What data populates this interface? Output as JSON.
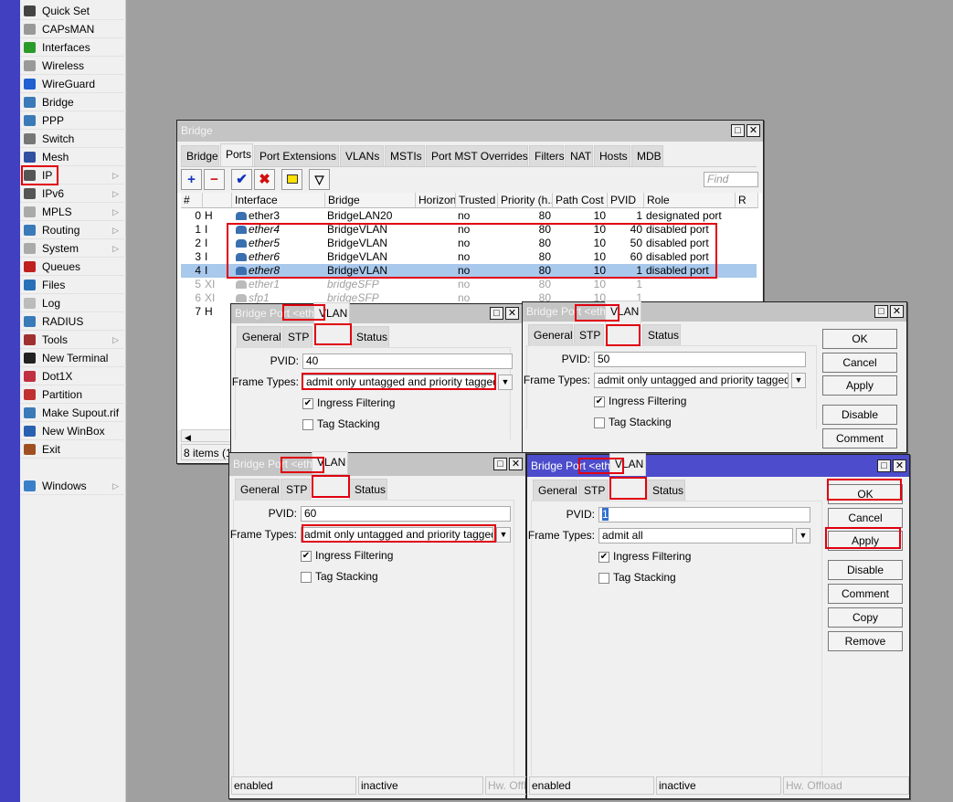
{
  "menu": [
    {
      "label": "Quick Set",
      "icon": "wand-icon",
      "color": "#444"
    },
    {
      "label": "CAPsMAN",
      "icon": "antenna-icon",
      "color": "#999"
    },
    {
      "label": "Interfaces",
      "icon": "nic-icon",
      "color": "#2a9a2a"
    },
    {
      "label": "Wireless",
      "icon": "antenna-icon",
      "color": "#999"
    },
    {
      "label": "WireGuard",
      "icon": "wireguard-icon",
      "color": "#2060d0"
    },
    {
      "label": "Bridge",
      "icon": "bridge-icon",
      "color": "#3a7ab8"
    },
    {
      "label": "PPP",
      "icon": "ppp-icon",
      "color": "#3a7ab8"
    },
    {
      "label": "Switch",
      "icon": "switch-icon",
      "color": "#777"
    },
    {
      "label": "Mesh",
      "icon": "mesh-icon",
      "color": "#3050a0"
    },
    {
      "label": "IP",
      "icon": "ip-icon",
      "color": "#555",
      "submenu": true
    },
    {
      "label": "IPv6",
      "icon": "ipv6-icon",
      "color": "#555",
      "submenu": true
    },
    {
      "label": "MPLS",
      "icon": "mpls-icon",
      "color": "#aaa",
      "submenu": true
    },
    {
      "label": "Routing",
      "icon": "routing-icon",
      "color": "#3a7ab8",
      "submenu": true
    },
    {
      "label": "System",
      "icon": "gear-icon",
      "color": "#aaa",
      "submenu": true
    },
    {
      "label": "Queues",
      "icon": "queues-icon",
      "color": "#c02020"
    },
    {
      "label": "Files",
      "icon": "folder-icon",
      "color": "#2a70b8"
    },
    {
      "label": "Log",
      "icon": "log-icon",
      "color": "#bbb"
    },
    {
      "label": "RADIUS",
      "icon": "radius-icon",
      "color": "#3a7ab8"
    },
    {
      "label": "Tools",
      "icon": "tools-icon",
      "color": "#a03030",
      "submenu": true
    },
    {
      "label": "New Terminal",
      "icon": "terminal-icon",
      "color": "#222"
    },
    {
      "label": "Dot1X",
      "icon": "dot1x-icon",
      "color": "#c03040"
    },
    {
      "label": "Partition",
      "icon": "partition-icon",
      "color": "#c03030"
    },
    {
      "label": "Make Supout.rif",
      "icon": "supout-icon",
      "color": "#3a7ab8"
    },
    {
      "label": "New WinBox",
      "icon": "winbox-icon",
      "color": "#2a60b0"
    },
    {
      "label": "Exit",
      "icon": "exit-icon",
      "color": "#a05020"
    },
    {
      "label": "Windows",
      "icon": "windows-icon",
      "color": "#3a80c8",
      "submenu": true
    }
  ],
  "bridge": {
    "title": "Bridge",
    "tabs": [
      "Bridge",
      "Ports",
      "Port Extensions",
      "VLANs",
      "MSTIs",
      "Port MST Overrides",
      "Filters",
      "NAT",
      "Hosts",
      "MDB"
    ],
    "active_tab": "Ports",
    "find_placeholder": "Find",
    "columns": [
      "#",
      "",
      "Interface",
      "Bridge",
      "Horizon",
      "Trusted",
      "Priority (h...",
      "Path Cost",
      "PVID",
      "Role",
      "R"
    ],
    "rows": [
      {
        "num": "0",
        "flags": "H",
        "iface": "ether3",
        "bridge": "BridgeLAN20",
        "horizon": "",
        "trusted": "no",
        "priority": "80",
        "cost": "10",
        "pvid": "1",
        "role": "designated port"
      },
      {
        "num": "1",
        "flags": "I",
        "iface": "ether4",
        "bridge": "BridgeVLAN",
        "horizon": "",
        "trusted": "no",
        "priority": "80",
        "cost": "10",
        "pvid": "40",
        "role": "disabled port",
        "italic": true
      },
      {
        "num": "2",
        "flags": "I",
        "iface": "ether5",
        "bridge": "BridgeVLAN",
        "horizon": "",
        "trusted": "no",
        "priority": "80",
        "cost": "10",
        "pvid": "50",
        "role": "disabled port",
        "italic": true
      },
      {
        "num": "3",
        "flags": "I",
        "iface": "ether6",
        "bridge": "BridgeVLAN",
        "horizon": "",
        "trusted": "no",
        "priority": "80",
        "cost": "10",
        "pvid": "60",
        "role": "disabled port",
        "italic": true
      },
      {
        "num": "4",
        "flags": "I",
        "iface": "ether8",
        "bridge": "BridgeVLAN",
        "horizon": "",
        "trusted": "no",
        "priority": "80",
        "cost": "10",
        "pvid": "1",
        "role": "disabled port",
        "italic": true,
        "selected": true
      },
      {
        "num": "5",
        "flags": "XI",
        "iface": "ether1",
        "bridge": "bridgeSFP",
        "horizon": "",
        "trusted": "no",
        "priority": "80",
        "cost": "10",
        "pvid": "1",
        "role": "",
        "disabled": true
      },
      {
        "num": "6",
        "flags": "XI",
        "iface": "sfp1",
        "bridge": "bridgeSFP",
        "horizon": "",
        "trusted": "no",
        "priority": "80",
        "cost": "10",
        "pvid": "1",
        "role": "",
        "disabled": true
      },
      {
        "num": "7",
        "flags": "H",
        "iface": "",
        "bridge": "",
        "horizon": "",
        "trusted": "",
        "priority": "",
        "cost": "",
        "pvid": "",
        "role": ""
      }
    ],
    "status": "8 items (1 s"
  },
  "dialogs": [
    {
      "title": "Bridge Port",
      "name": "<ether4>",
      "tabs": [
        "General",
        "STP",
        "VLAN",
        "Status"
      ],
      "active_tab": "VLAN",
      "pvid_label": "PVID:",
      "pvid": "40",
      "frame_label": "Frame Types:",
      "frame_types": "admit only untagged and priority tagged",
      "ingress_label": "Ingress Filtering",
      "ingress": true,
      "tag_label": "Tag Stacking",
      "tag": false,
      "buttons": [],
      "status": []
    },
    {
      "title": "Bridge Port",
      "name": "<ether5>",
      "tabs": [
        "General",
        "STP",
        "VLAN",
        "Status"
      ],
      "active_tab": "VLAN",
      "pvid_label": "PVID:",
      "pvid": "50",
      "frame_label": "Frame Types:",
      "frame_types": "admit only untagged and priority tagged",
      "ingress_label": "Ingress Filtering",
      "ingress": true,
      "tag_label": "Tag Stacking",
      "tag": false,
      "buttons": [
        "OK",
        "Cancel",
        "Apply",
        "Disable",
        "Comment"
      ],
      "status": []
    },
    {
      "title": "Bridge Port",
      "name": "<ether6>",
      "tabs": [
        "General",
        "STP",
        "VLAN",
        "Status"
      ],
      "active_tab": "VLAN",
      "pvid_label": "PVID:",
      "pvid": "60",
      "frame_label": "Frame Types:",
      "frame_types": "admit only untagged and priority tagged",
      "ingress_label": "Ingress Filtering",
      "ingress": true,
      "tag_label": "Tag Stacking",
      "tag": false,
      "buttons": [],
      "status": [
        "enabled",
        "inactive",
        "Hw. Offload"
      ]
    },
    {
      "title": "Bridge Port",
      "name": "<ether8>",
      "tabs": [
        "General",
        "STP",
        "VLAN",
        "Status"
      ],
      "active_tab": "VLAN",
      "pvid_label": "PVID:",
      "pvid": "1",
      "frame_label": "Frame Types:",
      "frame_types": "admit all",
      "ingress_label": "Ingress Filtering",
      "ingress": true,
      "tag_label": "Tag Stacking",
      "tag": false,
      "buttons": [
        "OK",
        "Cancel",
        "Apply",
        "Disable",
        "Comment",
        "Copy",
        "Remove"
      ],
      "status": [
        "enabled",
        "inactive",
        "Hw. Offload"
      ],
      "active": true
    }
  ],
  "colors": {
    "highlight": "#e00010",
    "active_title": "#4c4ccc",
    "selected_row": "#a8c8ec",
    "sidebar_strip": "#4040c0"
  }
}
